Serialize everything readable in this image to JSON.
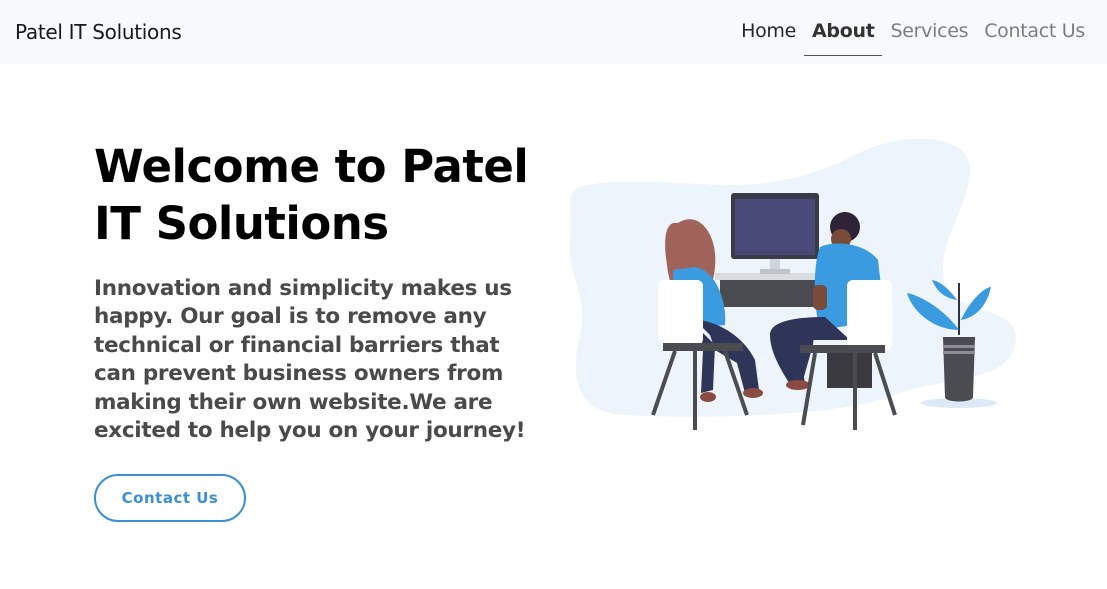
{
  "navbar": {
    "brand": "Patel IT Solutions",
    "links": [
      {
        "label": "Home"
      },
      {
        "label": "About"
      },
      {
        "label": "Services"
      },
      {
        "label": "Contact Us"
      }
    ]
  },
  "hero": {
    "title": "Welcome to Patel IT Solutions",
    "description": "Innovation and simplicity makes us happy. Our goal is to remove any technical or financial barriers that can prevent business owners from making their own website.We are excited to help you on your journey!",
    "cta_label": "Contact Us"
  },
  "colors": {
    "accent": "#3b8fd4",
    "navbar_bg": "#f8f9fa",
    "illustration_blob": "#eef4fb",
    "shirt_blue": "#3b9be0",
    "monitor": "#4a4a78"
  },
  "illustration": {
    "name": "people-working-at-computer-illustration"
  }
}
